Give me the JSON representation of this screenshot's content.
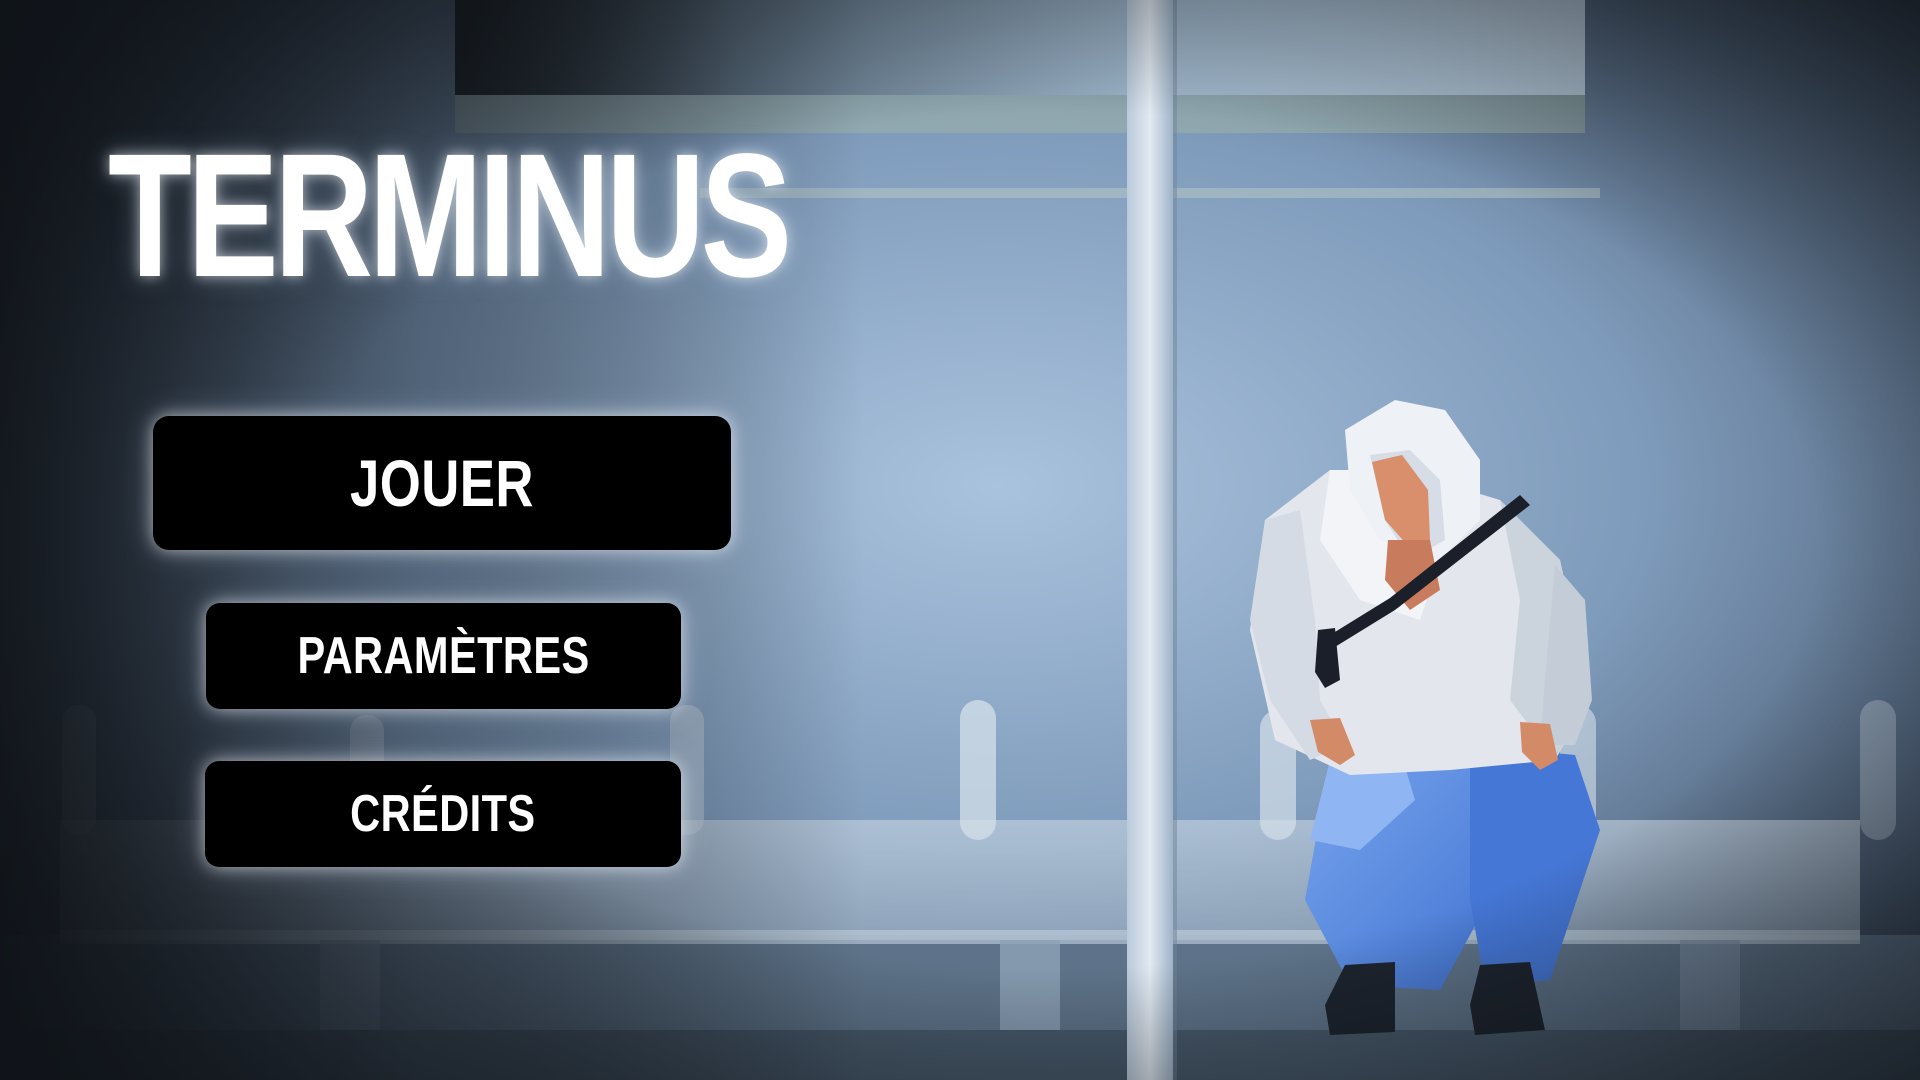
{
  "game": {
    "title": "TERMINUS"
  },
  "menu": {
    "play_label": "JOUER",
    "settings_label": "PARAMÈTRES",
    "credits_label": "CRÉDITS"
  },
  "colors": {
    "button_bg": "#000000",
    "button_text": "#ffffff",
    "title_text": "#ffffff",
    "scene_wall": "#8aa5c4",
    "scene_vignette": "#1b2129",
    "character_pants": "#4f86e0",
    "character_hoodie": "#e4e8ee"
  }
}
